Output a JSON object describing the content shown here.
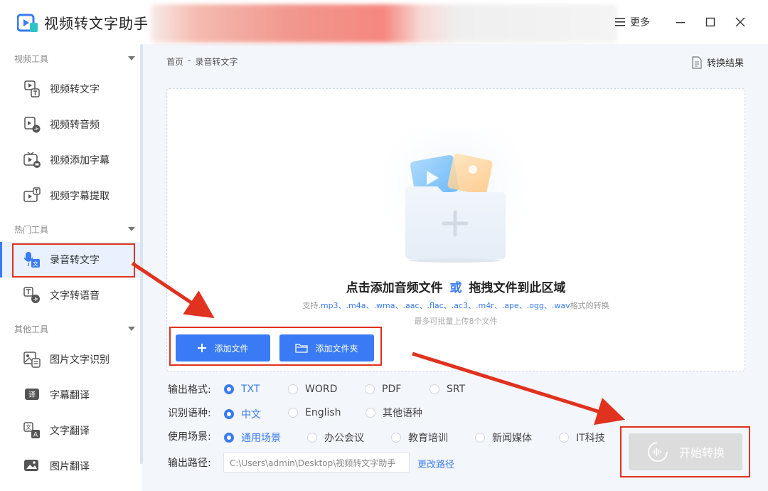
{
  "app": {
    "title": "视频转文字助手"
  },
  "window": {
    "more_label": "更多"
  },
  "sidebar": {
    "sections": [
      {
        "title": "视频工具",
        "items": [
          {
            "label": "视频转文字",
            "icon": "video-to-text-icon"
          },
          {
            "label": "视频转音频",
            "icon": "video-to-audio-icon"
          },
          {
            "label": "视频添加字幕",
            "icon": "video-add-subtitle-icon"
          },
          {
            "label": "视频字幕提取",
            "icon": "video-subtitle-extract-icon"
          }
        ]
      },
      {
        "title": "热门工具",
        "items": [
          {
            "label": "录音转文字",
            "icon": "mic-to-text-icon",
            "active": true
          },
          {
            "label": "文字转语音",
            "icon": "text-to-speech-icon"
          }
        ]
      },
      {
        "title": "其他工具",
        "items": [
          {
            "label": "图片文字识别",
            "icon": "image-ocr-icon"
          },
          {
            "label": "字幕翻译",
            "icon": "subtitle-translate-icon"
          },
          {
            "label": "文字翻译",
            "icon": "text-translate-icon"
          },
          {
            "label": "图片翻译",
            "icon": "image-translate-icon"
          }
        ]
      }
    ]
  },
  "breadcrumb": {
    "home": "首页",
    "sep": "-",
    "current": "录音转文字"
  },
  "result_button": "转换结果",
  "dropzone": {
    "title_part1": "点击添加音频文件",
    "title_or": "或",
    "title_part2": "拖拽文件到此区域",
    "support_prefix": "支持",
    "support_formats": ".mp3、.m4a、.wma、.aac、.flac、.ac3、.m4r、.ape、.ogg、.wav",
    "support_suffix": "格式的转换",
    "limit": "最多可批量上传8个文件",
    "add_file": "添加文件",
    "add_folder": "添加文件夹"
  },
  "options": {
    "format": {
      "label": "输出格式:",
      "choices": [
        "TXT",
        "WORD",
        "PDF",
        "SRT"
      ],
      "selected": "TXT"
    },
    "language": {
      "label": "识别语种:",
      "choices": [
        "中文",
        "English",
        "其他语种"
      ],
      "selected": "中文"
    },
    "scene": {
      "label": "使用场景:",
      "choices": [
        "通用场景",
        "办公会议",
        "教育培训",
        "新闻媒体",
        "IT科技"
      ],
      "selected": "通用场景"
    },
    "path": {
      "label": "输出路径:",
      "value": "C:\\Users\\admin\\Desktop\\视频转文字助手",
      "change": "更改路径"
    }
  },
  "start_button": "开始转换",
  "colors": {
    "accent": "#3a7bf5",
    "annotation": "#e0321e",
    "disabled": "#dcdcdc"
  }
}
